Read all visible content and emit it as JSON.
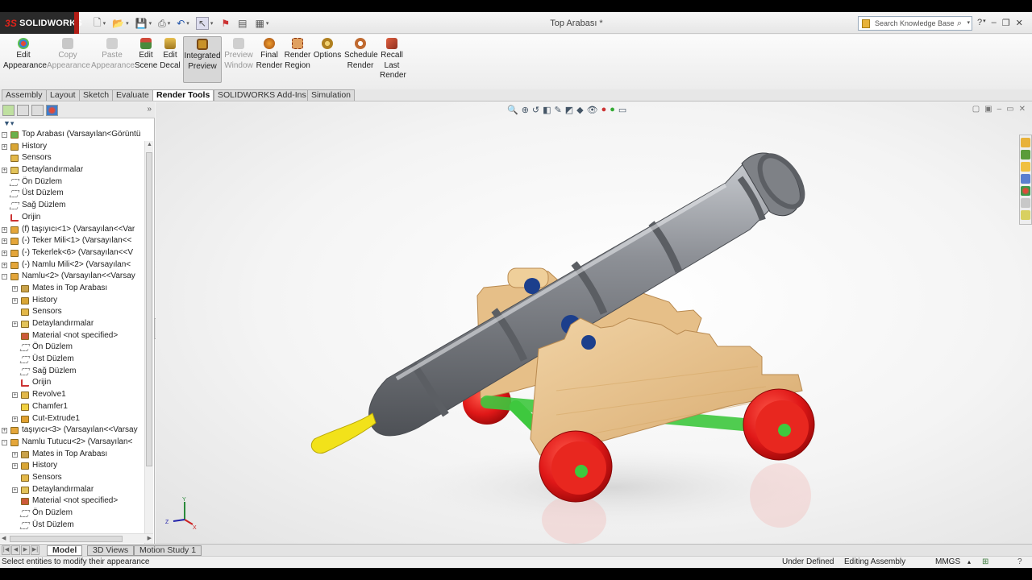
{
  "app": {
    "brand": "SOLIDWORKS",
    "document_title": "Top Arabası *"
  },
  "search": {
    "placeholder": "Search Knowledge Base"
  },
  "commands": [
    {
      "label1": "Edit",
      "label2": "Appearance",
      "state": "enabled",
      "color": "#d0463a"
    },
    {
      "label1": "Copy",
      "label2": "Appearance",
      "state": "disabled",
      "color": "#aaaaaa"
    },
    {
      "label1": "Paste",
      "label2": "Appearance",
      "state": "disabled",
      "color": "#bbbbbb"
    },
    {
      "label1": "Edit",
      "label2": "Scene",
      "state": "enabled",
      "color": "#4a8a3c"
    },
    {
      "label1": "Edit",
      "label2": "Decal",
      "state": "enabled",
      "color": "#c8a030"
    },
    {
      "label1": "Integrated",
      "label2": "Preview",
      "state": "active",
      "color": "#b05a2a"
    },
    {
      "label1": "Preview",
      "label2": "Window",
      "state": "disabled",
      "color": "#a0a0a0"
    },
    {
      "label1": "Final",
      "label2": "Render",
      "state": "enabled",
      "color": "#c66a20"
    },
    {
      "label1": "Render",
      "label2": "Region",
      "state": "enabled",
      "color": "#b0502c"
    },
    {
      "label1": "Options",
      "label2": "",
      "state": "enabled",
      "color": "#c89030"
    },
    {
      "label1": "Schedule",
      "label2": "Render",
      "state": "enabled",
      "color": "#c06a30"
    },
    {
      "label1": "Recall",
      "label2": "Last Render",
      "state": "enabled",
      "color": "#b0402a"
    }
  ],
  "tabs": [
    "Assembly",
    "Layout",
    "Sketch",
    "Evaluate",
    "Render Tools",
    "SOLIDWORKS Add-Ins",
    "Simulation"
  ],
  "active_tab": "Render Tools",
  "tree": [
    {
      "level": 0,
      "exp": "-",
      "icon": "assembly",
      "label": "Top Arabası  (Varsayılan<Görüntü"
    },
    {
      "level": 0,
      "exp": "+",
      "icon": "history",
      "label": "History"
    },
    {
      "level": 0,
      "exp": "",
      "icon": "sensor",
      "label": "Sensors"
    },
    {
      "level": 0,
      "exp": "+",
      "icon": "annotation",
      "label": "Detaylandırmalar"
    },
    {
      "level": 0,
      "exp": "",
      "icon": "plane",
      "label": "Ön Düzlem"
    },
    {
      "level": 0,
      "exp": "",
      "icon": "plane",
      "label": "Üst Düzlem"
    },
    {
      "level": 0,
      "exp": "",
      "icon": "plane",
      "label": "Sağ Düzlem"
    },
    {
      "level": 0,
      "exp": "",
      "icon": "origin",
      "label": "Orijin"
    },
    {
      "level": 0,
      "exp": "+",
      "icon": "part",
      "label": "(f) taşıyıcı<1> (Varsayılan<<Var"
    },
    {
      "level": 0,
      "exp": "+",
      "icon": "part",
      "label": "(-) Teker Mili<1> (Varsayılan<<"
    },
    {
      "level": 0,
      "exp": "+",
      "icon": "part",
      "label": "(-) Tekerlek<6> (Varsayılan<<V"
    },
    {
      "level": 0,
      "exp": "+",
      "icon": "part",
      "label": "(-) Namlu Mili<2> (Varsayılan<"
    },
    {
      "level": 0,
      "exp": "-",
      "icon": "part",
      "label": "Namlu<2> (Varsayılan<<Varsay"
    },
    {
      "level": 1,
      "exp": "+",
      "icon": "mates",
      "label": "Mates in Top Arabası"
    },
    {
      "level": 1,
      "exp": "+",
      "icon": "history",
      "label": "History"
    },
    {
      "level": 1,
      "exp": "",
      "icon": "sensor",
      "label": "Sensors"
    },
    {
      "level": 1,
      "exp": "+",
      "icon": "annotation",
      "label": "Detaylandırmalar"
    },
    {
      "level": 1,
      "exp": "",
      "icon": "material",
      "label": "Material <not specified>"
    },
    {
      "level": 1,
      "exp": "",
      "icon": "plane",
      "label": "Ön Düzlem"
    },
    {
      "level": 1,
      "exp": "",
      "icon": "plane",
      "label": "Üst Düzlem"
    },
    {
      "level": 1,
      "exp": "",
      "icon": "plane",
      "label": "Sağ Düzlem"
    },
    {
      "level": 1,
      "exp": "",
      "icon": "origin",
      "label": "Orijin"
    },
    {
      "level": 1,
      "exp": "+",
      "icon": "revolve",
      "label": "Revolve1"
    },
    {
      "level": 1,
      "exp": "",
      "icon": "chamfer",
      "label": "Chamfer1"
    },
    {
      "level": 1,
      "exp": "+",
      "icon": "cut",
      "label": "Cut-Extrude1"
    },
    {
      "level": 0,
      "exp": "+",
      "icon": "part",
      "label": "taşıyıcı<3> (Varsayılan<<Varsay"
    },
    {
      "level": 0,
      "exp": "-",
      "icon": "part",
      "label": "Namlu Tutucu<2> (Varsayılan<"
    },
    {
      "level": 1,
      "exp": "+",
      "icon": "mates",
      "label": "Mates in Top Arabası"
    },
    {
      "level": 1,
      "exp": "+",
      "icon": "history",
      "label": "History"
    },
    {
      "level": 1,
      "exp": "",
      "icon": "sensor",
      "label": "Sensors"
    },
    {
      "level": 1,
      "exp": "+",
      "icon": "annotation",
      "label": "Detaylandırmalar"
    },
    {
      "level": 1,
      "exp": "",
      "icon": "material",
      "label": "Material <not specified>"
    },
    {
      "level": 1,
      "exp": "",
      "icon": "plane",
      "label": "Ön Düzlem"
    },
    {
      "level": 1,
      "exp": "",
      "icon": "plane",
      "label": "Üst Düzlem"
    }
  ],
  "bottom_tabs": [
    "Model",
    "3D Views",
    "Motion Study 1"
  ],
  "active_bottom_tab": "Model",
  "status": {
    "message": "Select entities to modify their appearance",
    "definition": "Under Defined",
    "mode": "Editing Assembly",
    "units": "MMGS"
  },
  "colors": {
    "brand_red": "#e2231a",
    "wheel_red": "#e01818",
    "wood": "#e9c592",
    "barrel": "#8d9096",
    "axle_green": "#3ec83e",
    "flame_yellow": "#f2e21a"
  }
}
